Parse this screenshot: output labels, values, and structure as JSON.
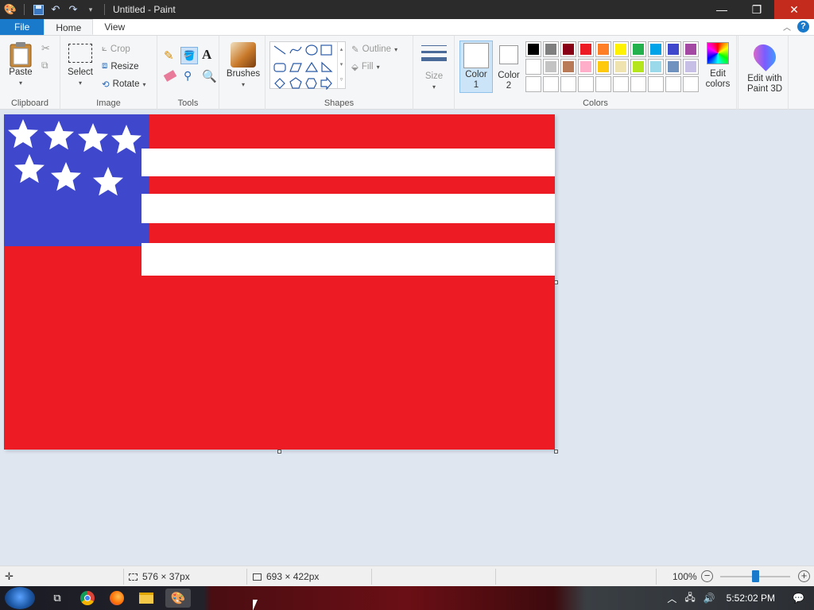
{
  "app": {
    "title": "Untitled - Paint"
  },
  "titlebar": {
    "minimize_icon": "minimize-icon",
    "maximize_icon": "restore-icon",
    "close_icon": "close-icon"
  },
  "tabs": [
    {
      "label": "File"
    },
    {
      "label": "Home"
    },
    {
      "label": "View"
    }
  ],
  "ribbon": {
    "clipboard": {
      "label": "Clipboard",
      "paste": "Paste"
    },
    "image": {
      "label": "Image",
      "select": "Select",
      "crop": "Crop",
      "resize": "Resize",
      "rotate": "Rotate"
    },
    "tools": {
      "label": "Tools"
    },
    "brushes": {
      "label": "Brushes"
    },
    "shapes": {
      "label": "Shapes",
      "outline": "Outline",
      "fill": "Fill"
    },
    "size": {
      "label": "Size"
    },
    "colors": {
      "label": "Colors",
      "color1": "Color",
      "color1_num": "1",
      "color2": "Color",
      "color2_num": "2",
      "edit_colors": "Edit",
      "edit_colors2": "colors",
      "palette": [
        "#000000",
        "#7f7f7f",
        "#880015",
        "#ed1c24",
        "#ff7f27",
        "#fff200",
        "#22b14c",
        "#00a2e8",
        "#3f48cc",
        "#a349a4",
        "#ffffff",
        "#c3c3c3",
        "#b97a57",
        "#ffaec9",
        "#ffc90e",
        "#efe4b0",
        "#b5e61d",
        "#99d9ea",
        "#7092be",
        "#c8bfe7",
        "#ffffff",
        "#ffffff",
        "#ffffff",
        "#ffffff",
        "#ffffff",
        "#ffffff",
        "#ffffff",
        "#ffffff",
        "#ffffff",
        "#ffffff"
      ]
    },
    "paint3d": {
      "line1": "Edit with",
      "line2": "Paint 3D"
    }
  },
  "canvas_colors": {
    "red": "#ed1c24",
    "blue": "#3f48cc",
    "white": "#ffffff"
  },
  "status": {
    "selection_size": "576 × 37px",
    "image_size": "693 × 422px",
    "zoom": "100%"
  },
  "taskbar": {
    "time": "5:52:02 PM"
  }
}
